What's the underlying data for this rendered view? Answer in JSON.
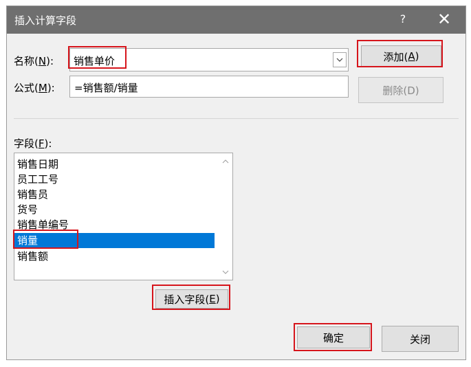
{
  "dialog": {
    "title": "插入计算字段",
    "help_label": "?",
    "close_label": "✕"
  },
  "name_field": {
    "label_prefix": "名称(",
    "label_key": "N",
    "label_suffix": "):",
    "value": "销售单价"
  },
  "formula_field": {
    "label_prefix": "公式(",
    "label_key": "M",
    "label_suffix": "):",
    "value": "=销售额/销量"
  },
  "buttons": {
    "add_prefix": "添加(",
    "add_key": "A",
    "add_suffix": ")",
    "delete": "删除(D)",
    "insert_field_prefix": "插入字段(",
    "insert_field_key": "E",
    "insert_field_suffix": ")",
    "ok": "确定",
    "close": "关闭"
  },
  "fields": {
    "label_prefix": "字段(",
    "label_key": "F",
    "label_suffix": "):",
    "items": [
      "销售日期",
      "员工工号",
      "销售员",
      "货号",
      "销售单编号",
      "销量",
      "销售额"
    ],
    "selected": "销量"
  },
  "colors": {
    "highlight": "#d6141b",
    "selection": "#0078d7",
    "titlebar": "#6f6f6f"
  }
}
